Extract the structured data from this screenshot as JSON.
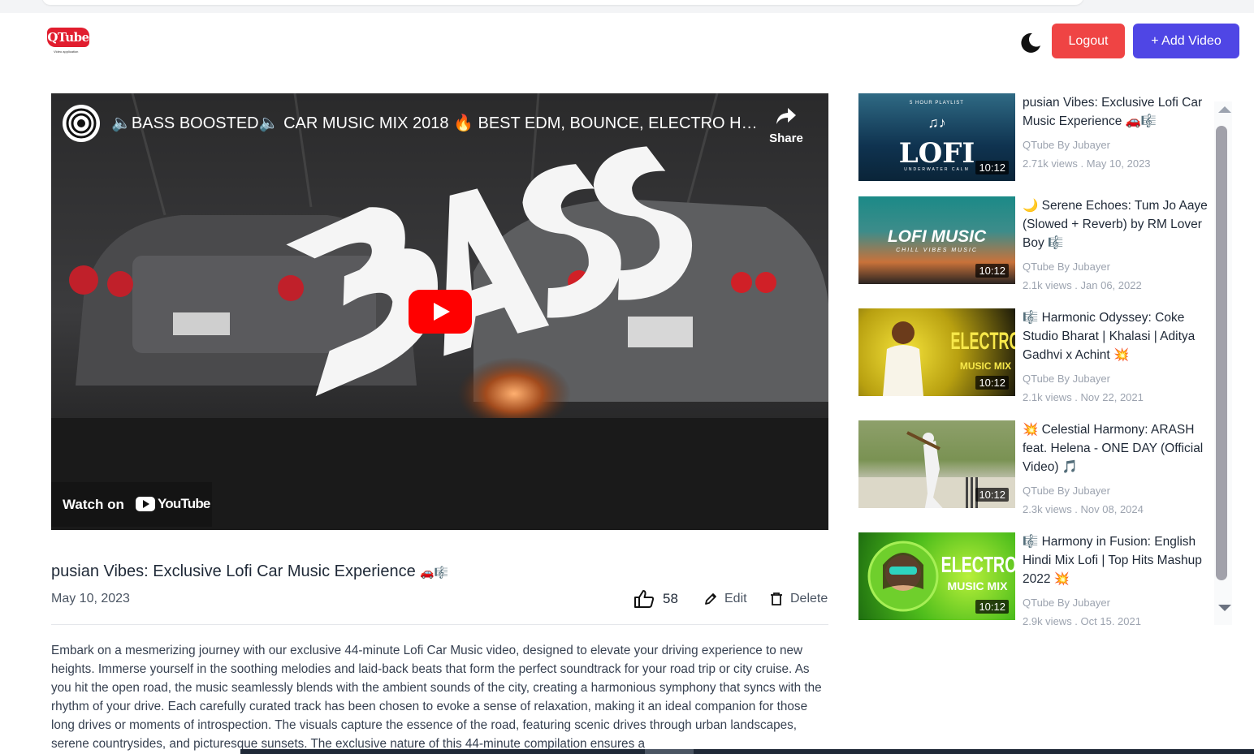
{
  "header": {
    "logo_text": "QTube",
    "logo_sub": "Video application",
    "logout_label": "Logout",
    "add_video_label": "+ Add Video"
  },
  "player": {
    "title": "🔈BASS BOOSTED🔈 CAR MUSIC MIX 2018 🔥 BEST EDM, BOUNCE, ELECTRO HOUSE...",
    "share_label": "Share",
    "watch_on_label": "Watch on",
    "youtube_word": "YouTube",
    "overlay_word": "BASS"
  },
  "video": {
    "title": "pusian Vibes: Exclusive Lofi Car Music Experience",
    "title_emojis": "🚗🎼",
    "date": "May 10, 2023",
    "likes": "58",
    "edit_label": "Edit",
    "delete_label": "Delete",
    "description": "Embark on a mesmerizing journey with our exclusive 44-minute Lofi Car Music video, designed to elevate your driving experience to new heights. Immerse yourself in the soothing melodies and laid-back beats that form the perfect soundtrack for your road trip or city cruise. As you hit the open road, the music seamlessly blends with the ambient sounds of the city, creating a harmonious symphony that syncs with the rhythm of your drive. Each carefully curated track has been chosen to evoke a sense of relaxation, making it an ideal companion for those long drives or moments of introspection. The visuals capture the essence of the road, featuring scenic drives through urban landscapes, serene countrysides, and picturesque sunsets. The exclusive nature of this 44-minute compilation ensures a"
  },
  "sidebar": {
    "items": [
      {
        "title": "pusian Vibes: Exclusive Lofi Car Music Experience 🚗🎼",
        "channel": "QTube By Jubayer",
        "meta": "2.71k views . May 10, 2023",
        "duration": "10:12",
        "thumb_text": "LOFI",
        "thumb_sub": "UNDERWATER CALM",
        "thumb_top": "5 HOUR PLAYLIST"
      },
      {
        "title": "🌙 Serene Echoes: Tum Jo Aaye (Slowed + Reverb) by RM Lover Boy 🎼",
        "channel": "QTube By Jubayer",
        "meta": "2.1k views . Jan 06, 2022",
        "duration": "10:12",
        "thumb_text": "LOFI MUSIC",
        "thumb_sub": "CHILL VIBES MUSIC"
      },
      {
        "title": "🎼 Harmonic Odyssey: Coke Studio Bharat | Khalasi | Aditya Gadhvi x Achint 💥",
        "channel": "QTube By Jubayer",
        "meta": "2.1k views . Nov 22, 2021",
        "duration": "10:12",
        "thumb_text": "ELECTRO",
        "thumb_sub": "MUSIC MIX"
      },
      {
        "title": "💥 Celestial Harmony: ARASH feat. Helena - ONE DAY (Official Video) 🎵",
        "channel": "QTube By Jubayer",
        "meta": "2.3k views . Nov 08, 2024",
        "duration": "10:12"
      },
      {
        "title": "🎼 Harmony in Fusion: English Hindi Mix Lofi | Top Hits Mashup 2022 💥",
        "channel": "QTube By Jubayer",
        "meta": "2.9k views . Oct 15, 2021",
        "duration": "10:12",
        "thumb_text": "ELECTRO",
        "thumb_sub": "MUSIC MIX"
      }
    ]
  },
  "colors": {
    "logout": "#ef4444",
    "add_video": "#4f46e5",
    "youtube_red": "#ff0000"
  }
}
